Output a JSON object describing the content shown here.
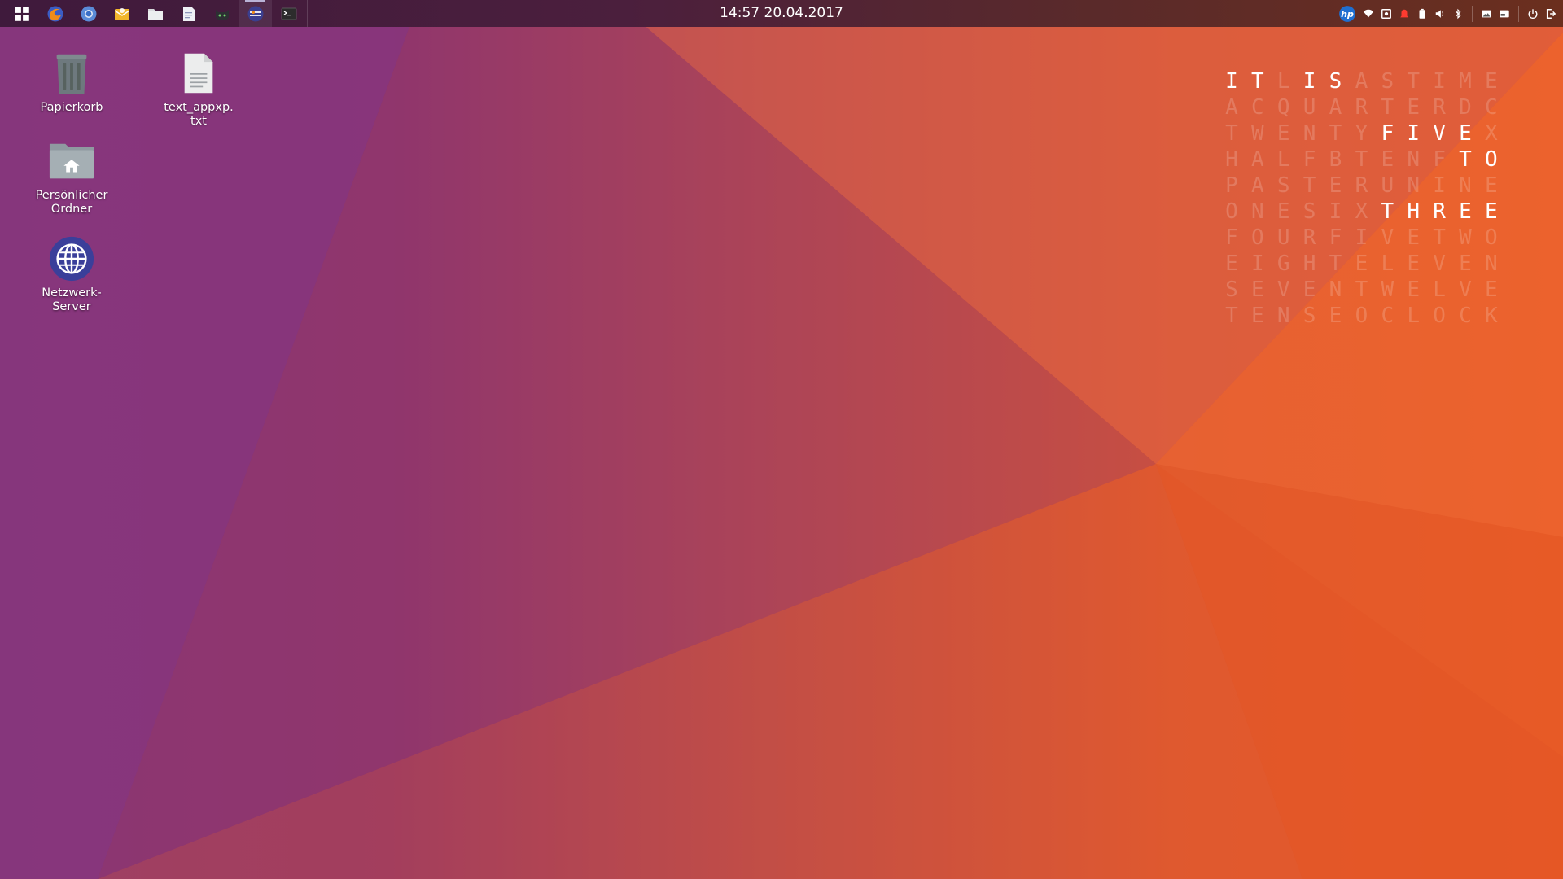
{
  "panel": {
    "clock_time": "14:57",
    "clock_date": "20.04.2017",
    "launchers": [
      {
        "name": "apps-grid-icon"
      },
      {
        "name": "firefox-icon"
      },
      {
        "name": "chromium-icon"
      },
      {
        "name": "mail-icon"
      },
      {
        "name": "files-icon"
      },
      {
        "name": "text-editor-icon"
      },
      {
        "name": "github-cat-icon"
      },
      {
        "name": "settings-sliders-icon",
        "active": true
      },
      {
        "name": "terminal-icon"
      }
    ],
    "tray": [
      "hp-icon",
      "wifi-icon",
      "screenshot-icon",
      "notification-icon",
      "battery-icon",
      "volume-icon",
      "bluetooth-icon",
      "photo-icon",
      "keyboard-icon",
      "power-icon",
      "logout-icon"
    ],
    "hp_label": "hp"
  },
  "desktop": {
    "icons": [
      {
        "label": "Papierkorb"
      },
      {
        "label": "text_appxp.\ntxt"
      },
      {
        "label": "Persönlicher\nOrdner"
      },
      {
        "label": "Netzwerk-\nServer"
      }
    ]
  },
  "word_clock": {
    "rows": [
      "ITLISASTIME",
      "ACQUARTERDC",
      "TWENTYFIVEX",
      "HALFBTENFTO",
      "PASTERUNINE",
      "ONESIXTHREE",
      "FOURFIVETWO",
      "EIGHTELEVEN",
      "SEVENTWELVE",
      "TENSEOCLOCK"
    ],
    "lit": [
      [
        0,
        0
      ],
      [
        0,
        1
      ],
      [
        0,
        3
      ],
      [
        0,
        4
      ],
      [
        2,
        6
      ],
      [
        2,
        7
      ],
      [
        2,
        8
      ],
      [
        2,
        9
      ],
      [
        3,
        9
      ],
      [
        3,
        10
      ],
      [
        5,
        6
      ],
      [
        5,
        7
      ],
      [
        5,
        8
      ],
      [
        5,
        9
      ],
      [
        5,
        10
      ]
    ]
  },
  "colors": {
    "wallpaper_purple": "#7a2f74",
    "wallpaper_orange": "#e95420"
  }
}
